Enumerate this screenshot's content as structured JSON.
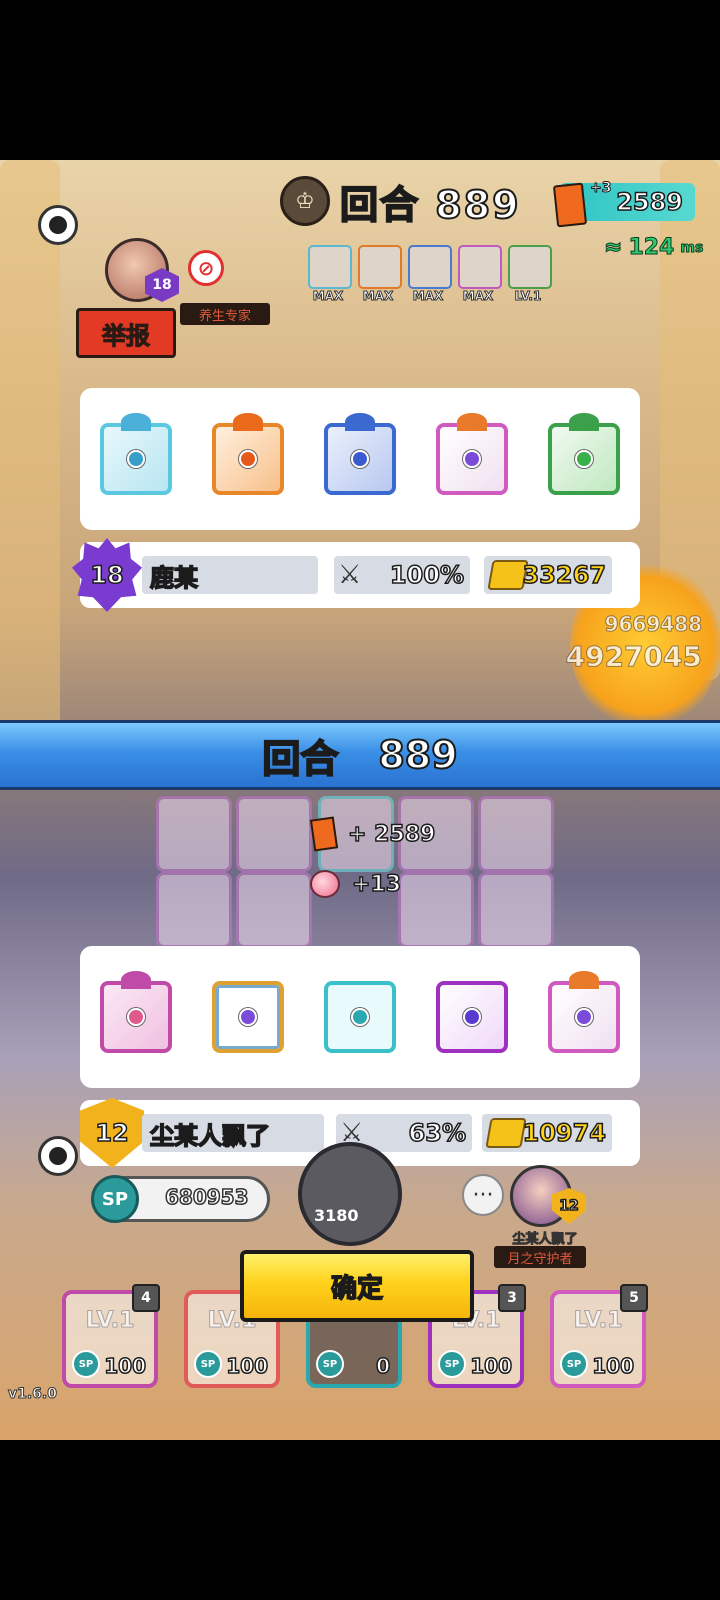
{
  "colors": {
    "banner_blue": "#3a8fe6",
    "confirm_yellow": "#ffd21c",
    "report_red": "#e23a24",
    "ping_green": "#2ecc71",
    "cards_teal": "#2ec4c4",
    "gold_text": "#ffd21c"
  },
  "top": {
    "round_label": "回合 889",
    "cards_plus": "+3",
    "cards_value": "2589",
    "ping_value": "124",
    "ping_unit": "ms",
    "small_dice_levels": [
      "MAX",
      "MAX",
      "MAX",
      "MAX",
      "LV.1"
    ],
    "player_level": "18",
    "player_title": "养生专家",
    "report_label": "举报",
    "bg_score_1": "9669488",
    "bg_score_2": "4927045"
  },
  "opponent_panel": {
    "dice": [
      "ice-dice",
      "fire-dice",
      "wind-dice",
      "infinity-dice",
      "poison-dice"
    ],
    "rank": "18",
    "name": "鹿某",
    "win_rate": "100%",
    "trophies": "33267"
  },
  "banner": {
    "label": "回合",
    "number": "889"
  },
  "rewards": {
    "cards": "+ 2589",
    "peaches": "+13"
  },
  "player_panel": {
    "dice": [
      "sword-dice",
      "rainbow-dice",
      "teal-plus-dice",
      "purple-arrow-dice",
      "infinity-dice"
    ],
    "rank": "12",
    "name": "尘某人飘了",
    "win_rate": "63%",
    "trophies": "10974"
  },
  "bottom": {
    "sp_label": "SP",
    "sp_value": "680953",
    "summon_cost": "3180",
    "more_label": "···",
    "opponent_name": "尘某人飘了",
    "opponent_title": "月之守护者",
    "opponent_level": "12",
    "confirm_label": "确定",
    "version": "v1.6.0",
    "deck": [
      {
        "level": "LV.1",
        "count": "4",
        "sp": "SP",
        "cost": "100"
      },
      {
        "level": "LV.1",
        "count": "",
        "sp": "SP",
        "cost": "100"
      },
      {
        "level": "",
        "count": "",
        "sp": "SP",
        "cost": "0"
      },
      {
        "level": "LV.1",
        "count": "3",
        "sp": "SP",
        "cost": "100"
      },
      {
        "level": "LV.1",
        "count": "5",
        "sp": "SP",
        "cost": "100"
      }
    ]
  }
}
